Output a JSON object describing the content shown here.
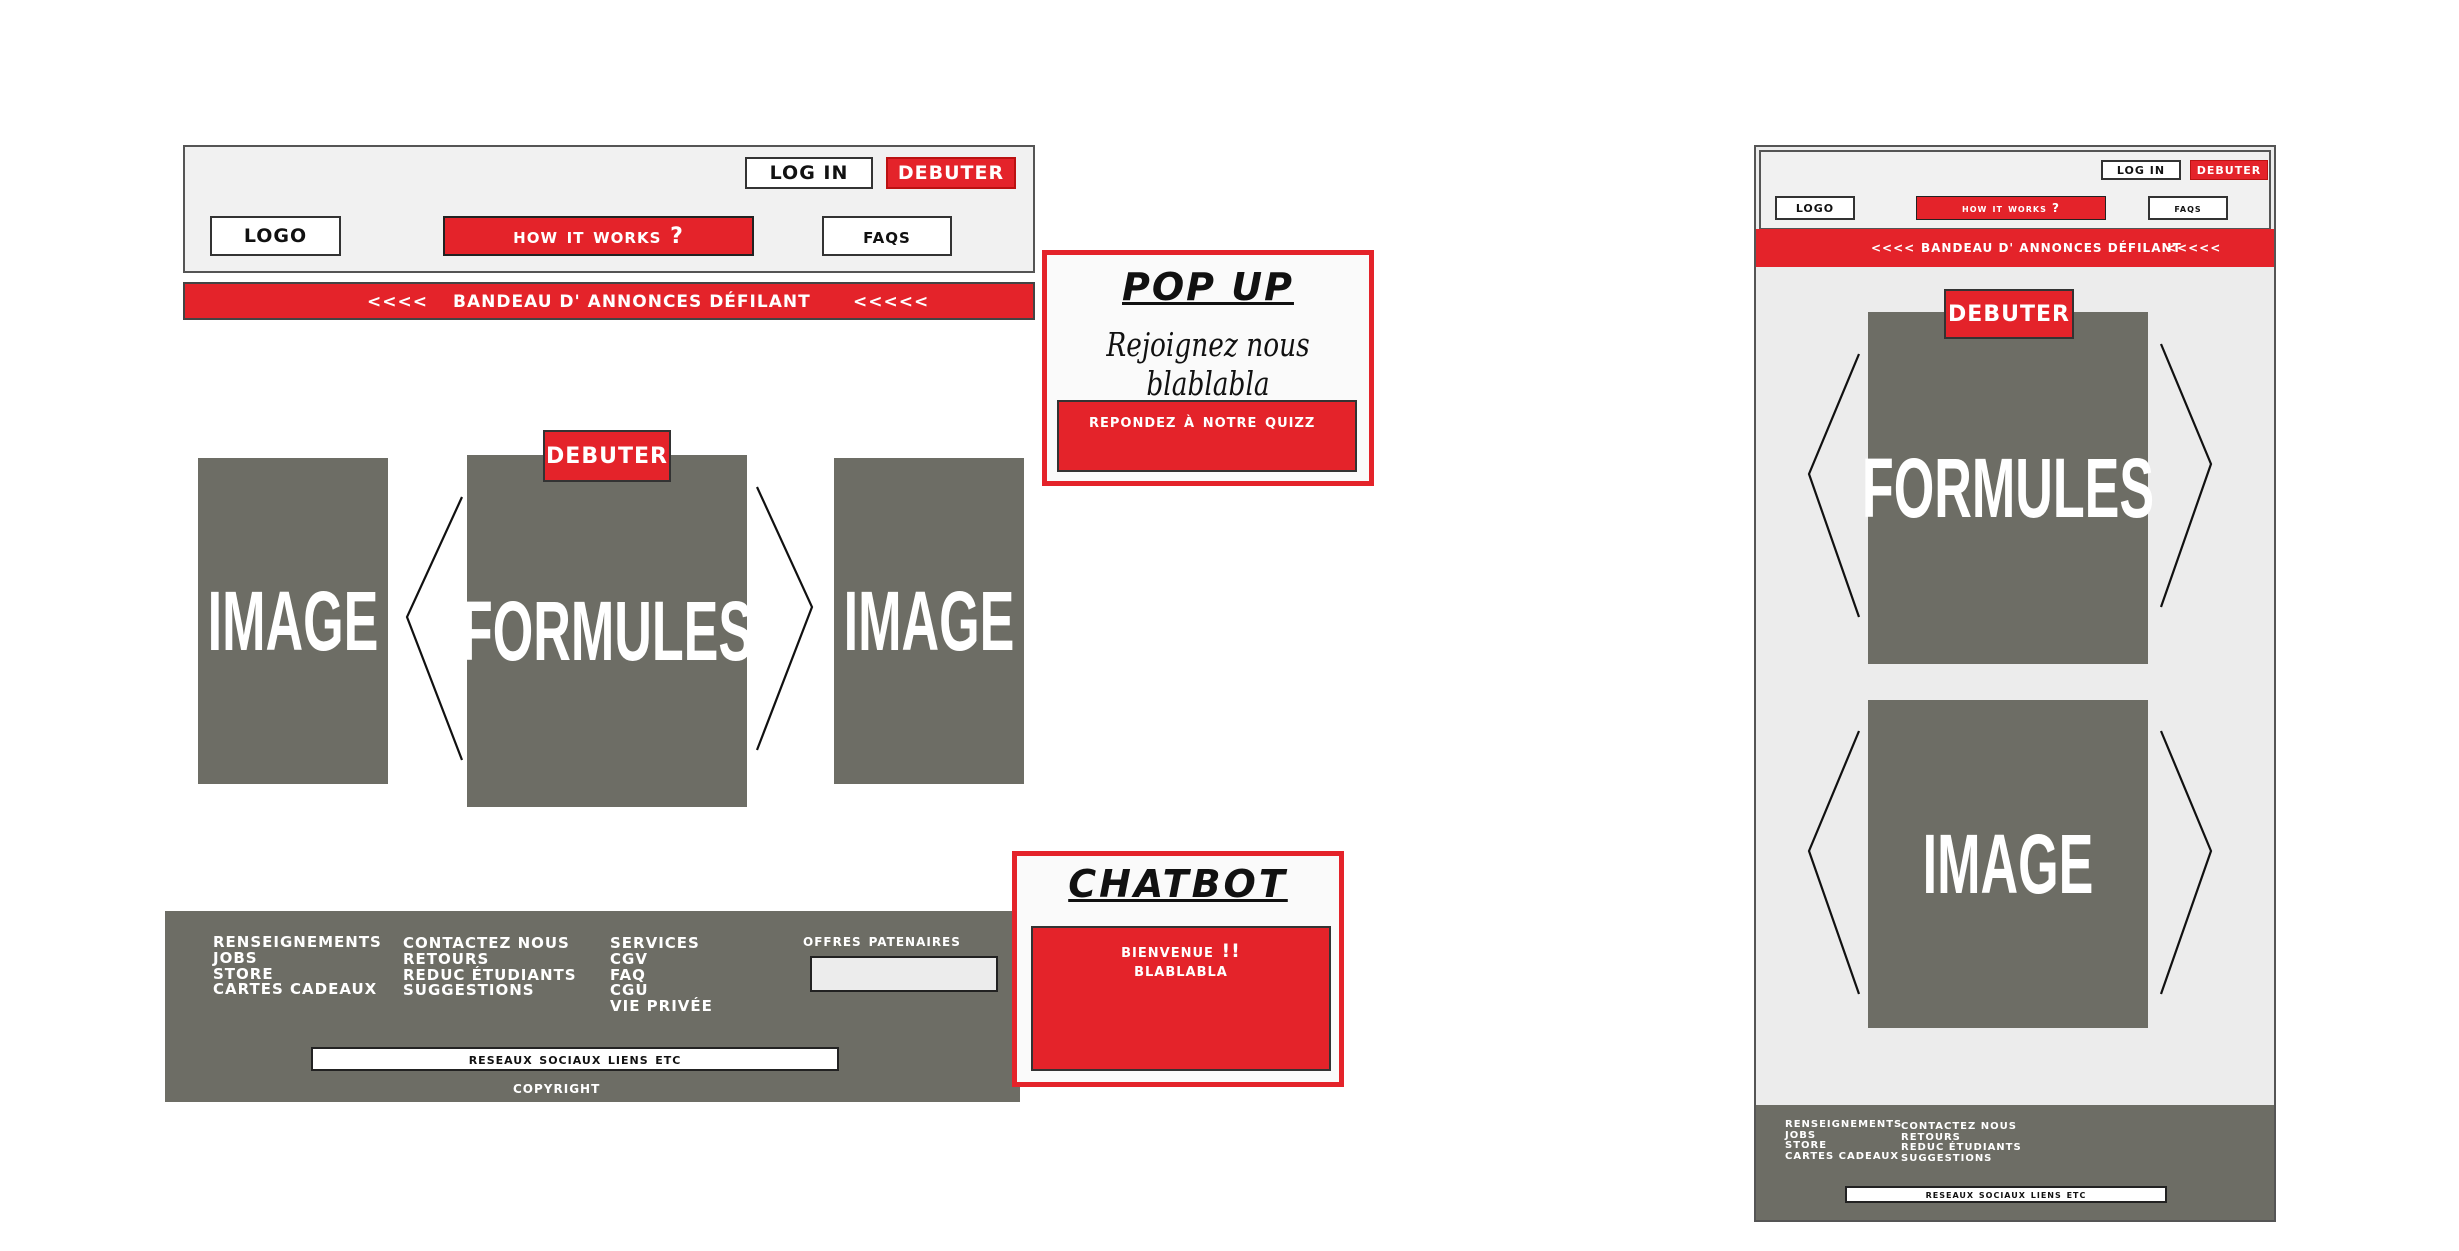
{
  "desktop": {
    "header": {
      "login_label": "LOG IN",
      "debuter_label": "DEBUTER",
      "logo_label": "LOGO",
      "how_label": "How it works ?",
      "faq_label": "FAQs"
    },
    "banner": {
      "left_arrows": "<<<<",
      "text": "BANDEAU D' ANNONCES DÉFILANT",
      "right_arrows": "<<<<<"
    },
    "carousel": {
      "left_image": "IMAGE",
      "center_label": "FORMULES",
      "center_button": "DEBUTER",
      "right_image": "IMAGE"
    },
    "popup": {
      "title": "POP UP",
      "text": "Rejoignez nous blablabla",
      "button_label": "Repondez à notre quizz"
    },
    "chatbot": {
      "title": "CHATBOT",
      "message_line1": "Bienvenue !!",
      "message_line2": "blablabla"
    },
    "footer": {
      "col1": [
        "RENSEIGNEMENTS",
        "JOBS",
        "STORE",
        "CARTES CADEAUX"
      ],
      "col2": [
        "CONTACTEZ NOUS",
        "RETOURS",
        "REDUC ÉTUDIANTS",
        "SUGGESTIONS"
      ],
      "col3": [
        "SERVICES",
        "CGV",
        "FAQ",
        "CGU",
        "VIE PRIVÉE"
      ],
      "partners_label": "Offres Patenaires",
      "social_label": "Reseaux sociaux liens etc",
      "copyright": "COPYRIGHT"
    }
  },
  "mobile": {
    "header": {
      "login_label": "LOG IN",
      "debuter_label": "DEBUTER",
      "logo_label": "LOGO",
      "how_label": "How it works ?",
      "faq_label": "FAQs"
    },
    "banner": {
      "left_arrows": "<<<<",
      "text": "BANDEAU D' ANNONCES DÉFILANT",
      "right_arrows": "<<<<<"
    },
    "formules": {
      "button": "DEBUTER",
      "label": "FORMULES"
    },
    "image_label": "IMAGE",
    "footer": {
      "col1": [
        "RENSEIGNEMENTS",
        "JOBS",
        "STORE",
        "CARTES CADEAUX"
      ],
      "col2": [
        "CONTACTEZ NOUS",
        "RETOURS",
        "REDUC ÉTUDIANTS",
        "SUGGESTIONS"
      ],
      "social_label": "Reseaux sociaux liens etc"
    }
  },
  "colors": {
    "red": "#e4232a",
    "gray": "#6d6d65",
    "light_gray": "#ececec"
  }
}
